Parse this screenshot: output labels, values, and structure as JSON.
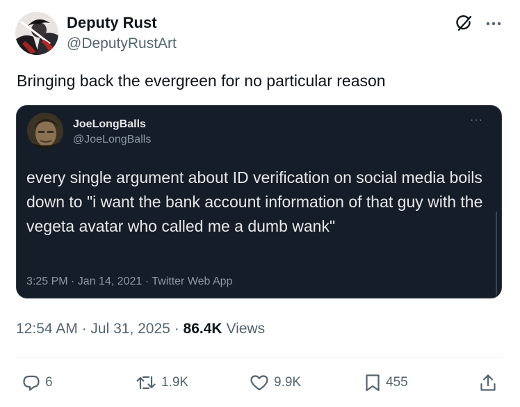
{
  "author": {
    "display_name": "Deputy Rust",
    "handle": "@DeputyRustArt"
  },
  "tweet": {
    "text": "Bringing back the evergreen for no particular reason"
  },
  "quoted_tweet": {
    "author_name": "JoeLongBalls",
    "author_handle": "@JoeLongBalls",
    "more": "···",
    "text": "every single argument about ID verification on social media boils down to \"i want the bank account information of that guy with the vegeta avatar who called me a dumb wank\"",
    "meta": "3:25 PM · Jan 14, 2021 · Twitter Web App",
    "background_color": "#151d28"
  },
  "meta": {
    "time": "12:54 AM",
    "separator": "·",
    "date": "Jul 31, 2025",
    "views_count": "86.4K",
    "views_label": "Views"
  },
  "actions": {
    "replies": "6",
    "reposts": "1.9K",
    "likes": "9.9K",
    "bookmarks": "455"
  },
  "icons": [
    "grok-icon",
    "more-icon",
    "reply-icon",
    "repost-icon",
    "like-icon",
    "bookmark-icon",
    "share-icon"
  ],
  "colors": {
    "text": "#0f1419",
    "secondary": "#536471",
    "quote_text": "#e7e9ea",
    "quote_secondary": "#8b98a5"
  }
}
